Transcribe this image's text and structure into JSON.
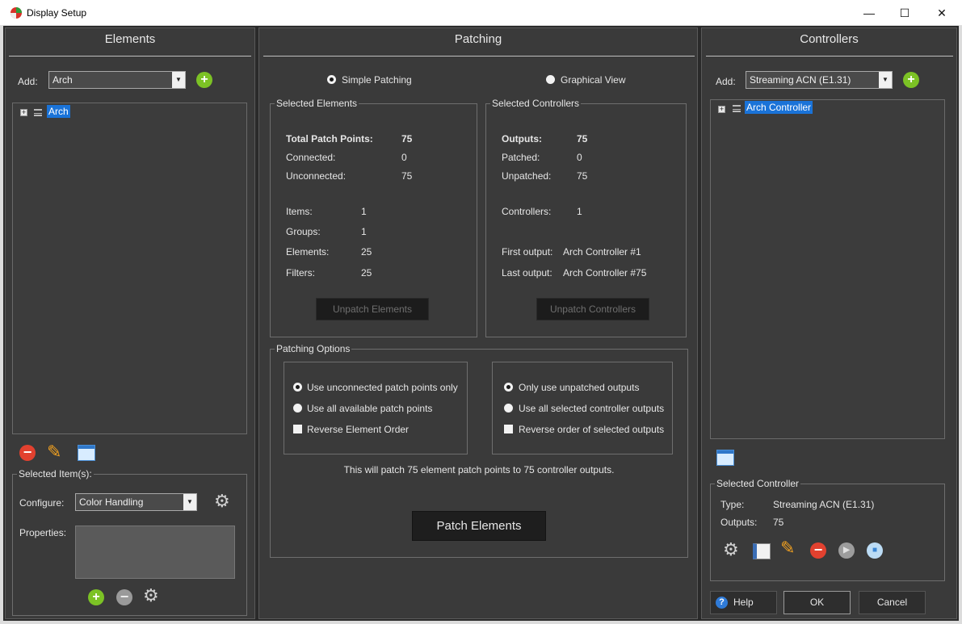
{
  "window": {
    "title": "Display Setup",
    "minimize_glyph": "—",
    "maximize_glyph": "☐",
    "close_glyph": "✕"
  },
  "elements_panel": {
    "title": "Elements",
    "add_label": "Add:",
    "add_combo_value": "Arch",
    "tree": [
      {
        "label": "Arch",
        "expander": "+",
        "selected": true
      }
    ],
    "selected_group_title": "Selected Item(s):",
    "configure_label": "Configure:",
    "configure_value": "Color Handling",
    "properties_label": "Properties:"
  },
  "patching_panel": {
    "title": "Patching",
    "view_simple": "Simple Patching",
    "view_graphical": "Graphical View",
    "selected_view": "Simple Patching",
    "selected_elements": {
      "group_title": "Selected Elements",
      "total_label": "Total Patch Points:",
      "total_value": "75",
      "connected_label": "Connected:",
      "connected_value": "0",
      "unconnected_label": "Unconnected:",
      "unconnected_value": "75",
      "items_label": "Items:",
      "items_value": "1",
      "groups_label": "Groups:",
      "groups_value": "1",
      "elements_label": "Elements:",
      "elements_value": "25",
      "filters_label": "Filters:",
      "filters_value": "25",
      "unpatch_button": "Unpatch Elements"
    },
    "selected_controllers": {
      "group_title": "Selected Controllers",
      "outputs_label": "Outputs:",
      "outputs_value": "75",
      "patched_label": "Patched:",
      "patched_value": "0",
      "unpatched_label": "Unpatched:",
      "unpatched_value": "75",
      "controllers_label": "Controllers:",
      "controllers_value": "1",
      "first_output_label": "First output:",
      "first_output_value": "Arch Controller #1",
      "last_output_label": "Last output:",
      "last_output_value": "Arch Controller #75",
      "unpatch_button": "Unpatch Controllers"
    },
    "options": {
      "group_title": "Patching Options",
      "element_options": {
        "radio_unconnected": "Use unconnected patch points only",
        "radio_all": "Use all available patch points",
        "checkbox_reverse": "Reverse Element Order",
        "selected": "unconnected",
        "reverse_checked": false
      },
      "controller_options": {
        "radio_unpatched": "Only use unpatched outputs",
        "radio_all": "Use all selected controller outputs",
        "checkbox_reverse": "Reverse order of selected outputs",
        "selected": "unpatched",
        "reverse_checked": false
      },
      "summary": "This will patch 75 element patch points to 75 controller outputs.",
      "patch_button": "Patch Elements"
    }
  },
  "controllers_panel": {
    "title": "Controllers",
    "add_label": "Add:",
    "add_combo_value": "Streaming ACN (E1.31)",
    "tree": [
      {
        "label": "Arch Controller",
        "expander": "+",
        "selected": true
      }
    ],
    "selected_group_title": "Selected Controller",
    "type_label": "Type:",
    "type_value": "Streaming ACN (E1.31)",
    "outputs_label": "Outputs:",
    "outputs_value": "75"
  },
  "dialog_buttons": {
    "help": "Help",
    "help_glyph": "?",
    "ok": "OK",
    "cancel": "Cancel"
  },
  "icons": {
    "plus_glyph": "+",
    "minus_glyph": "−",
    "pencil_glyph": "✎",
    "gear_glyph": "⚙",
    "play_glyph": "▶",
    "stop_glyph": "■",
    "combo_arrow_glyph": "▼"
  },
  "colors": {
    "accent_selection": "#1a73d8",
    "add_green": "#7cc225",
    "remove_red": "#e2412f",
    "panel_bg": "#3a3a3a"
  }
}
